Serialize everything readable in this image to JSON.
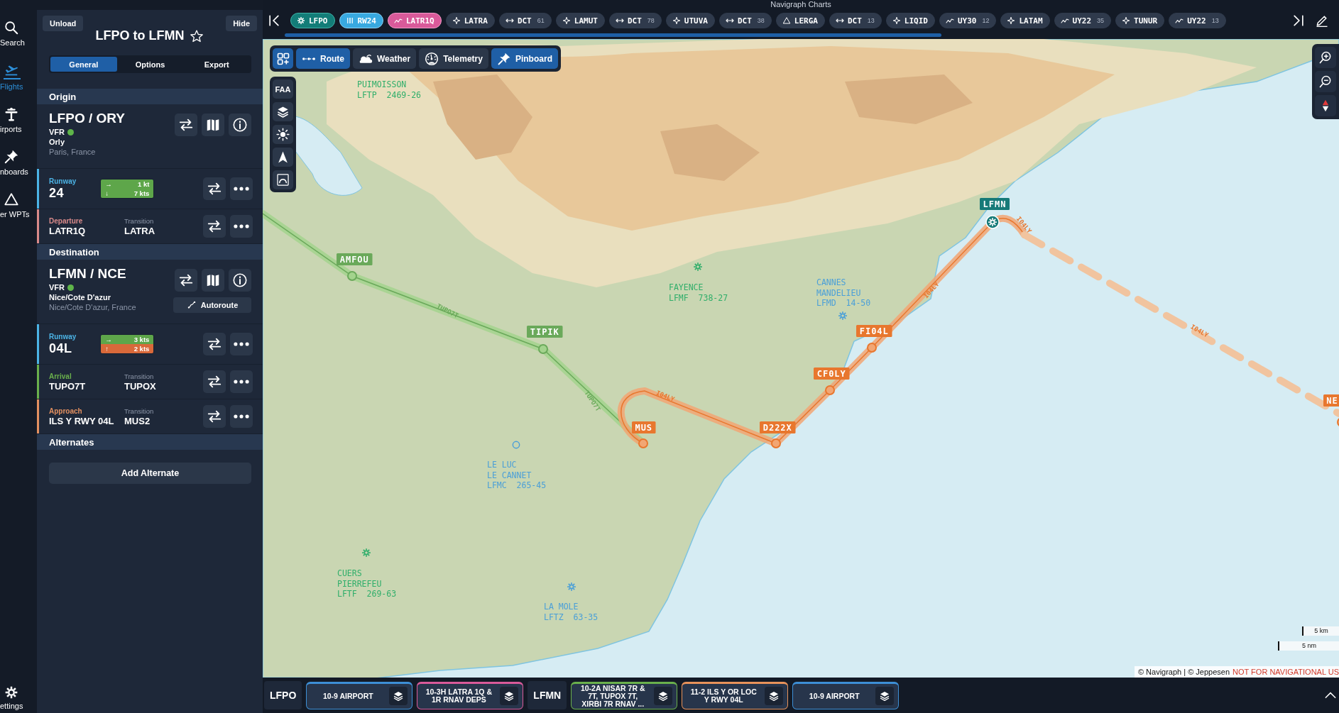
{
  "window": {
    "title": "Navigraph Charts"
  },
  "nav_rail": {
    "items": [
      {
        "label": "Search",
        "kind": "search",
        "selected": false
      },
      {
        "label": "Flights",
        "kind": "flights",
        "selected": true
      },
      {
        "label": "irports",
        "kind": "airports",
        "selected": false
      },
      {
        "label": "nboards",
        "kind": "pinboards",
        "selected": false
      },
      {
        "label": "er WPTs",
        "kind": "waypoints",
        "selected": false
      }
    ],
    "settings": "ettings"
  },
  "flight": {
    "unload": "Unload",
    "hide": "Hide",
    "title": "LFPO to LFMN",
    "favorite": false,
    "tabs": [
      {
        "label": "General",
        "selected": true
      },
      {
        "label": "Options",
        "selected": false
      },
      {
        "label": "Export",
        "selected": false
      }
    ],
    "sections": [
      {
        "heading": "Origin",
        "airport": {
          "code": "LFPO / ORY",
          "rules": "VFR",
          "name": "Orly",
          "location": "Paris, France"
        },
        "rows": [
          {
            "kind": "runway",
            "label": "Runway",
            "value": "24",
            "color": "#4cb4e6",
            "winds": [
              {
                "arrow": "→",
                "speed": "1 kt",
                "color": "#5ea64a"
              },
              {
                "arrow": "↓",
                "speed": "7 kts",
                "color": "#5ea64a"
              }
            ]
          },
          {
            "kind": "procedure",
            "label": "Departure",
            "value": "LATR1Q",
            "transition_label": "Transition",
            "transition": "LATRA",
            "color": "#d98a8a"
          }
        ]
      },
      {
        "heading": "Destination",
        "airport": {
          "code": "LFMN / NCE",
          "rules": "VFR",
          "name": "Nice/Cote D'azur",
          "location": "Nice/Cote D'azur, France",
          "autoroute": "Autoroute"
        },
        "rows": [
          {
            "kind": "runway",
            "label": "Runway",
            "value": "04L",
            "color": "#4cb4e6",
            "winds": [
              {
                "arrow": "→",
                "speed": "3 kts",
                "color": "#5ea64a"
              },
              {
                "arrow": "↑",
                "speed": "2 kts",
                "color": "#d9693a"
              }
            ]
          },
          {
            "kind": "procedure",
            "label": "Arrival",
            "value": "TUPO7T",
            "transition_label": "Transition",
            "transition": "TUPOX",
            "color": "#6ab04c"
          },
          {
            "kind": "procedure",
            "label": "Approach",
            "value": "ILS Y RWY 04L",
            "transition_label": "Transition",
            "transition": "MUS2",
            "color": "#e39060"
          }
        ]
      }
    ],
    "alternates": {
      "heading": "Alternates",
      "button": "Add Alternate"
    }
  },
  "route": [
    {
      "kind": "airport",
      "label": "LFPO"
    },
    {
      "kind": "runway",
      "label": "RW24"
    },
    {
      "kind": "departure",
      "label": "LATR1Q"
    },
    {
      "kind": "waypoint",
      "label": "LATRA"
    },
    {
      "kind": "airway",
      "label": "DCT",
      "count": "61"
    },
    {
      "kind": "waypoint",
      "label": "LAMUT"
    },
    {
      "kind": "airway",
      "label": "DCT",
      "count": "78"
    },
    {
      "kind": "waypoint",
      "label": "UTUVA"
    },
    {
      "kind": "airway",
      "label": "DCT",
      "count": "38"
    },
    {
      "kind": "user",
      "label": "LERGA"
    },
    {
      "kind": "airway",
      "label": "DCT",
      "count": "13"
    },
    {
      "kind": "waypoint",
      "label": "LIQID"
    },
    {
      "kind": "procedure",
      "label": "UY30",
      "count": "12"
    },
    {
      "kind": "waypoint",
      "label": "LATAM"
    },
    {
      "kind": "procedure",
      "label": "UY22",
      "count": "35"
    },
    {
      "kind": "waypoint",
      "label": "TUNUR"
    },
    {
      "kind": "procedure",
      "label": "UY22",
      "count": "13"
    }
  ],
  "map": {
    "toolbar": [
      {
        "kind": "route",
        "label": "Route",
        "selected": true
      },
      {
        "kind": "weather",
        "label": "Weather",
        "selected": false
      },
      {
        "kind": "telemetry",
        "label": "Telemetry",
        "selected": false
      },
      {
        "kind": "pinboard",
        "label": "Pinboard",
        "selected": true
      }
    ],
    "side_tool": "FAA",
    "waypoints": [
      {
        "label": "AMFOU",
        "kind": "arrival"
      },
      {
        "label": "TIPIK",
        "kind": "arrival"
      },
      {
        "label": "MUS",
        "kind": "approach"
      },
      {
        "label": "D222X",
        "kind": "approach"
      },
      {
        "label": "CF0LY",
        "kind": "approach"
      },
      {
        "label": "FI04L",
        "kind": "approach"
      },
      {
        "label": "LFMN",
        "kind": "airport"
      },
      {
        "label": "NE",
        "kind": "approach"
      }
    ],
    "airway_labels": [
      {
        "text": "TUPO7T",
        "kind": "arrival"
      },
      {
        "text": "TUPO7T",
        "kind": "arrival"
      },
      {
        "text": "I04LY",
        "kind": "approach"
      },
      {
        "text": "I04LY",
        "kind": "approach"
      },
      {
        "text": "I04LY",
        "kind": "approach"
      },
      {
        "text": "I04LY",
        "kind": "approach"
      }
    ],
    "airports": [
      {
        "lines": [
          "PUIMOISSON",
          "LFTP  2469-26"
        ],
        "color": "#2fae6a"
      },
      {
        "lines": [
          "FAYENCE",
          "LFMF  738-27"
        ],
        "color": "#2fae6a"
      },
      {
        "lines": [
          "CANNES",
          "MANDELIEU",
          "LFMD  14-50"
        ],
        "color": "#4a9fd8"
      },
      {
        "lines": [
          "LE LUC",
          "LE CANNET",
          "LFMC  265-45"
        ],
        "color": "#4a9fd8"
      },
      {
        "lines": [
          "CUERS",
          "PIERREFEU",
          "LFTF  269-63"
        ],
        "color": "#2fae6a"
      },
      {
        "lines": [
          "LA MOLE",
          "LFTZ  63-35"
        ],
        "color": "#4a9fd8"
      }
    ],
    "scale": [
      "5 km",
      "5 nm"
    ],
    "attribution": "© Navigraph | © Jeppesen",
    "notice": "NOT FOR NAVIGATIONAL US"
  },
  "charts": [
    {
      "airport": "LFPO",
      "items": [
        {
          "title": "10-9 AIRPORT",
          "color": "#3d8fd6"
        },
        {
          "title": "10-3H LATRA 1Q & 1R RNAV DEPS",
          "color": "#d95a9a"
        }
      ]
    },
    {
      "airport": "LFMN",
      "items": [
        {
          "title": "10-2A NISAR 7R & 7T, TUPOX 7T, XIRBI 7R RNAV ...",
          "color": "#6ab04c"
        },
        {
          "title": "11-2 ILS Y OR LOC Y RWY 04L",
          "color": "#e8925a"
        },
        {
          "title": "10-9 AIRPORT",
          "color": "#3d8fd6"
        }
      ]
    }
  ]
}
